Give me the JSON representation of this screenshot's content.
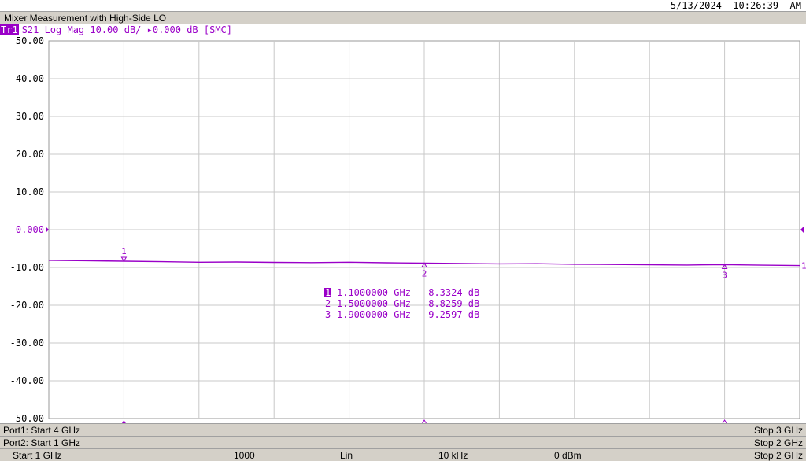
{
  "timestamp": "5/13/2024  10:26:39  AM",
  "window_title": "Mixer Measurement with High-Side LO",
  "trace": {
    "badge": "Tr1",
    "info": "S21 Log Mag 10.00 dB/ ▸0.000 dB [SMC]",
    "color": "#9a00c8"
  },
  "chart_data": {
    "type": "line",
    "ylim": [
      -50,
      50
    ],
    "xlim": [
      1.0,
      2.0
    ],
    "x_unit": "GHz",
    "y_unit": "dB",
    "grid": true,
    "y_ticks": [
      "50.00",
      "40.00",
      "30.00",
      "20.00",
      "10.00",
      "0.000",
      "-10.00",
      "-20.00",
      "-30.00",
      "-40.00",
      "-50.00"
    ],
    "y_tick_values": [
      50,
      40,
      30,
      20,
      10,
      0,
      -10,
      -20,
      -30,
      -40,
      -50
    ],
    "reference_level": 0,
    "series": [
      {
        "x": [
          1.0,
          1.05,
          1.1,
          1.15,
          1.2,
          1.25,
          1.3,
          1.35,
          1.4,
          1.45,
          1.5,
          1.55,
          1.6,
          1.65,
          1.7,
          1.75,
          1.8,
          1.85,
          1.9,
          1.95,
          2.0
        ],
        "y": [
          -8.1,
          -8.2,
          -8.33,
          -8.45,
          -8.6,
          -8.55,
          -8.65,
          -8.7,
          -8.6,
          -8.75,
          -8.83,
          -8.95,
          -9.05,
          -9.0,
          -9.15,
          -9.2,
          -9.3,
          -9.35,
          -9.26,
          -9.4,
          -9.5
        ]
      }
    ],
    "markers": [
      {
        "id": "1",
        "x": 1.1,
        "y": -8.3324,
        "label": "1.1000000 GHz",
        "value": "-8.3324 dB",
        "active": true
      },
      {
        "id": "2",
        "x": 1.5,
        "y": -8.8259,
        "label": "1.5000000 GHz",
        "value": "-8.8259 dB",
        "active": false
      },
      {
        "id": "3",
        "x": 1.9,
        "y": -9.2597,
        "label": "1.9000000 GHz",
        "value": "-9.2597 dB",
        "active": false
      }
    ],
    "right_edge_label": "1"
  },
  "status": {
    "port1_start": "Port1: Start 4 GHz",
    "port1_stop": "Stop 3 GHz",
    "port2_start": "Port2: Start 1 GHz",
    "port2_stop": "Stop 2 GHz",
    "start": "Start 1 GHz",
    "points": "1000",
    "sweep": "Lin",
    "ifbw": "10 kHz",
    "power": "0 dBm",
    "stop": "Stop 2 GHz"
  }
}
